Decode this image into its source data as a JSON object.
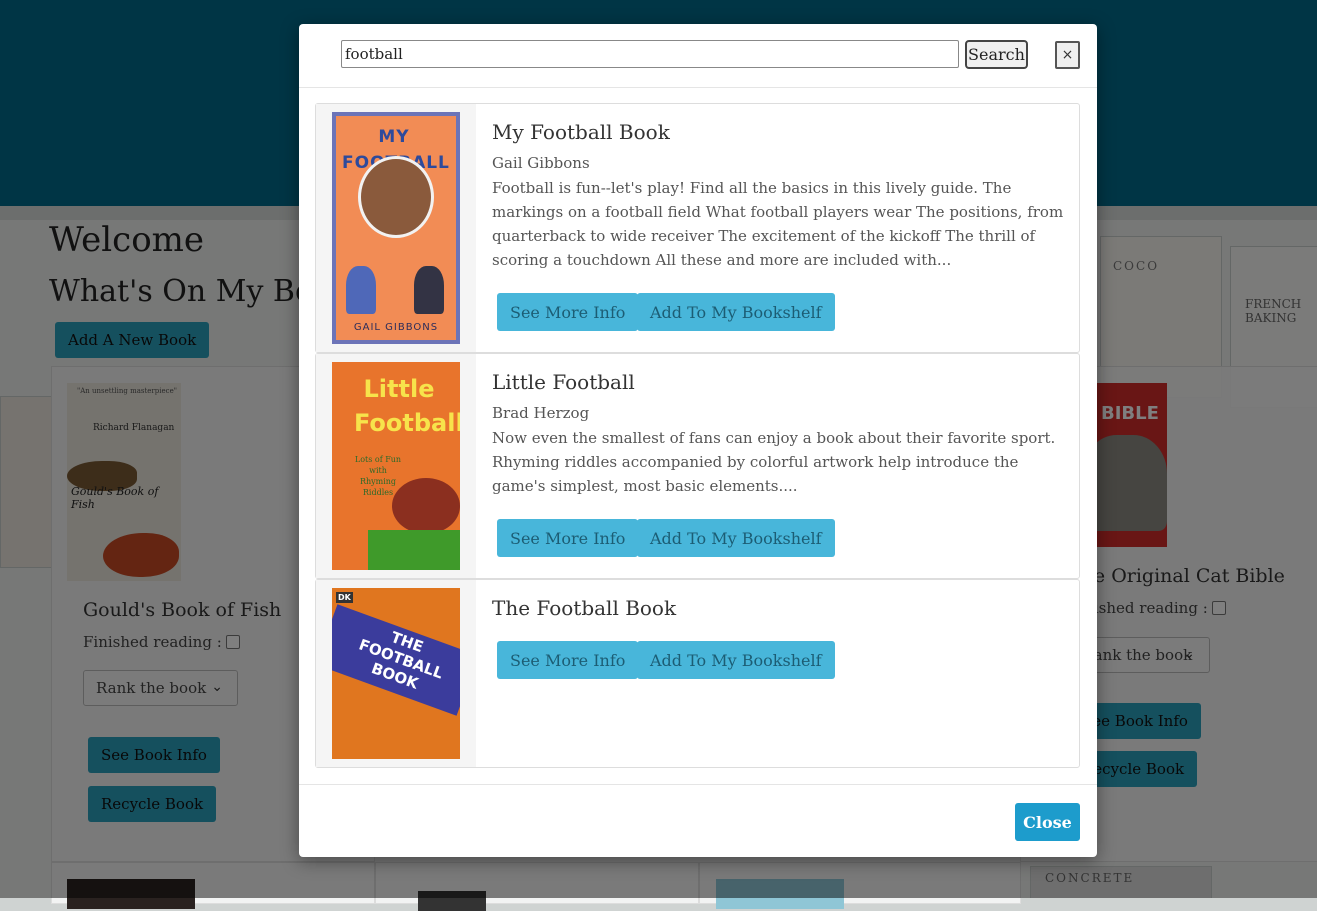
{
  "page": {
    "welcome": "Welcome",
    "subtitle": "What's On My Bookshelf",
    "add_button": "Add A New Book",
    "cards": [
      {
        "title": "Gould's Book of Fish",
        "finished_label": "Finished reading :",
        "rank_label": "Rank the book",
        "info_button": "See Book Info",
        "recycle_button": "Recycle Book",
        "cover_author": "Richard Flanagan",
        "cover_blurb": "\"An unsettling masterpiece\"",
        "cover_title": "Gould's Book of Fish"
      },
      {
        "title": "The Original Cat Bible",
        "finished_label": "Finished reading :",
        "rank_label": "Rank the book",
        "info_button": "See Book Info",
        "recycle_button": "Recycle Book",
        "cover_title": "BIBLE"
      }
    ],
    "shelf_labels": [
      "COCO",
      "FRENCH BAKING",
      "CONCRETE"
    ]
  },
  "search": {
    "value": "football",
    "button": "Search",
    "close_x": "×"
  },
  "results": [
    {
      "title": "My Football Book",
      "author": "Gail Gibbons",
      "description": "Football is fun--let's play! Find all the basics in this lively guide. The markings on a football field What football players wear The positions, from quarterback to wide receiver The excitement of the kickoff The thrill of scoring a touchdown All these and more are included with...",
      "more_button": "See More Info",
      "add_button": "Add To My Bookshelf",
      "cover_title": "MY FOOTBALL BOOK",
      "cover_author": "GAIL GIBBONS"
    },
    {
      "title": "Little Football",
      "author": "Brad Herzog",
      "description": "Now even the smallest of fans can enjoy a book about their favorite sport. Rhyming riddles accompanied by colorful artwork help introduce the game's simplest, most basic elements....",
      "more_button": "See More Info",
      "add_button": "Add To My Bookshelf",
      "cover_title": "Little Football",
      "cover_subtitle": "Lots of Fun with Rhyming Riddles"
    },
    {
      "title": "The Football Book",
      "author": "",
      "description": "",
      "more_button": "See More Info",
      "add_button": "Add To My Bookshelf",
      "cover_title": "THE FOOTBALL BOOK",
      "cover_badge": "DK"
    }
  ],
  "footer": {
    "close_button": "Close"
  },
  "colors": {
    "topbar": "#006b8a",
    "button_bg": "#48b6da",
    "button_text": "#1c5d74",
    "close_bg": "#1d9ccc"
  }
}
